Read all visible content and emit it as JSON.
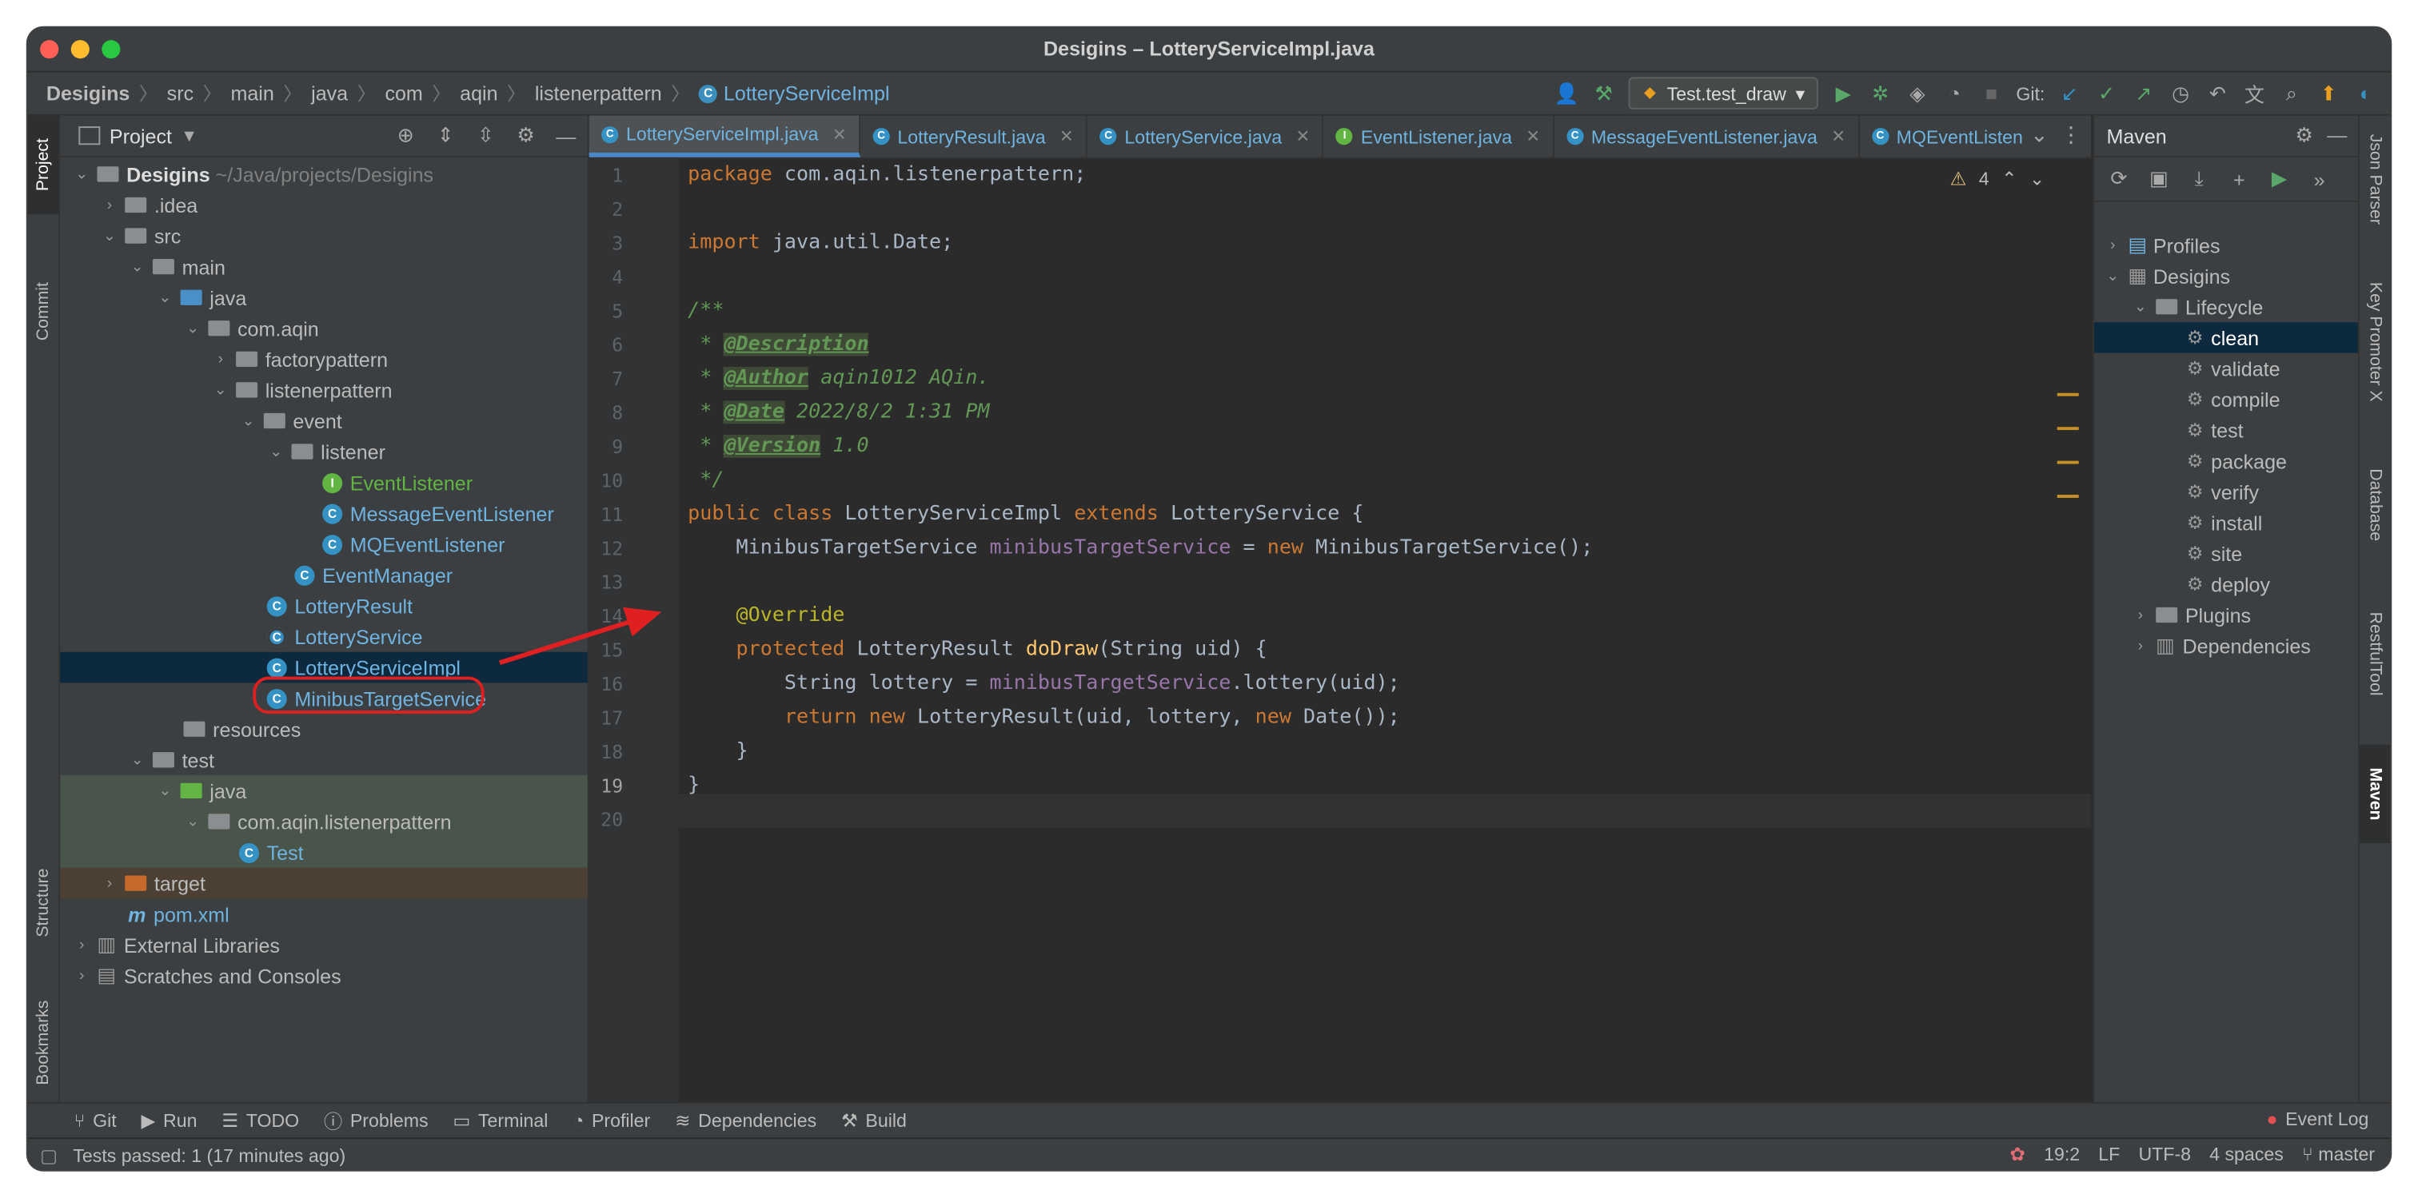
{
  "window": {
    "title": "Desigins – LotteryServiceImpl.java"
  },
  "breadcrumb": [
    "Desigins",
    "src",
    "main",
    "java",
    "com",
    "aqin",
    "listenerpattern",
    "LotteryServiceImpl"
  ],
  "toolbar": {
    "run_config": "Test.test_draw",
    "git_label": "Git:"
  },
  "left_tool_tabs": [
    "Project",
    "Commit",
    "Structure",
    "Bookmarks"
  ],
  "right_tool_tabs": [
    "Json Parser",
    "Key Promoter X",
    "Database",
    "RestfulTool",
    "Maven"
  ],
  "project_panel": {
    "title": "Project",
    "tree": [
      {
        "label": "Desigins",
        "suffix": "~/Java/projects/Desigins"
      },
      {
        "label": ".idea"
      },
      {
        "label": "src"
      },
      {
        "label": "main"
      },
      {
        "label": "java"
      },
      {
        "label": "com.aqin"
      },
      {
        "label": "factorypattern"
      },
      {
        "label": "listenerpattern"
      },
      {
        "label": "event"
      },
      {
        "label": "listener"
      },
      {
        "label": "EventListener"
      },
      {
        "label": "MessageEventListener"
      },
      {
        "label": "MQEventListener"
      },
      {
        "label": "EventManager"
      },
      {
        "label": "LotteryResult"
      },
      {
        "label": "LotteryService"
      },
      {
        "label": "LotteryServiceImpl"
      },
      {
        "label": "MinibusTargetService"
      },
      {
        "label": "resources"
      },
      {
        "label": "test"
      },
      {
        "label": "java"
      },
      {
        "label": "com.aqin.listenerpattern"
      },
      {
        "label": "Test"
      },
      {
        "label": "target"
      },
      {
        "label": "pom.xml"
      },
      {
        "label": "External Libraries"
      },
      {
        "label": "Scratches and Consoles"
      }
    ]
  },
  "editor": {
    "tabs": [
      "LotteryServiceImpl.java",
      "LotteryResult.java",
      "LotteryService.java",
      "EventListener.java",
      "MessageEventListener.java",
      "MQEventListen"
    ],
    "warnings": "4",
    "line_numbers": [
      "1",
      "2",
      "3",
      "4",
      "5",
      "6",
      "7",
      "8",
      "9",
      "10",
      "11",
      "12",
      "13",
      "14",
      "15",
      "16",
      "17",
      "18",
      "19",
      "20"
    ],
    "code": {
      "l1_kw": "package",
      "l1_rest": " com.aqin.listenerpattern;",
      "l3_kw": "import",
      "l3_rest": " java.util.Date;",
      "l5": "/**",
      "l6_star": " * ",
      "l6_tag": "@Description",
      "l7_star": " * ",
      "l7_tag": "@Author",
      "l7_text": " aqin1012 AQin.",
      "l8_star": " * ",
      "l8_tag": "@Date",
      "l8_text": " 2022/8/2 1:31 PM",
      "l9_star": " * ",
      "l9_tag": "@Version",
      "l9_text": " 1.0",
      "l10": " */",
      "l11_kw1": "public class",
      "l11_name": " LotteryServiceImpl ",
      "l11_kw2": "extends",
      "l11_rest": " LotteryService {",
      "l12_type": "    MinibusTargetService ",
      "l12_field": "minibusTargetService",
      "l12_eq": " = ",
      "l12_kw": "new",
      "l12_rest": " MinibusTargetService();",
      "l14": "    @Override",
      "l15_kw": "    protected",
      "l15_type": " LotteryResult ",
      "l15_fn": "doDraw",
      "l15_rest": "(String uid) {",
      "l16_a": "        String lottery = ",
      "l16_field": "minibusTargetService",
      "l16_rest": ".lottery(uid);",
      "l17_kw": "        return new",
      "l17_a": " LotteryResult(uid, lottery, ",
      "l17_kw2": "new",
      "l17_rest": " Date());",
      "l18": "    }",
      "l19": "}"
    }
  },
  "maven": {
    "title": "Maven",
    "items": [
      "Profiles",
      "Desigins",
      "Lifecycle",
      "clean",
      "validate",
      "compile",
      "test",
      "package",
      "verify",
      "install",
      "site",
      "deploy",
      "Plugins",
      "Dependencies"
    ]
  },
  "bottom_tabs": [
    "Git",
    "Run",
    "TODO",
    "Problems",
    "Terminal",
    "Profiler",
    "Dependencies",
    "Build"
  ],
  "event_log": "Event Log",
  "status": {
    "message": "Tests passed: 1 (17 minutes ago)",
    "position": "19:2",
    "line_sep": "LF",
    "encoding": "UTF-8",
    "indent": "4 spaces",
    "branch": "master"
  },
  "colors": {
    "selection": "#0d293e",
    "annotation_red": "#e02020",
    "accent_blue": "#3592c4"
  }
}
